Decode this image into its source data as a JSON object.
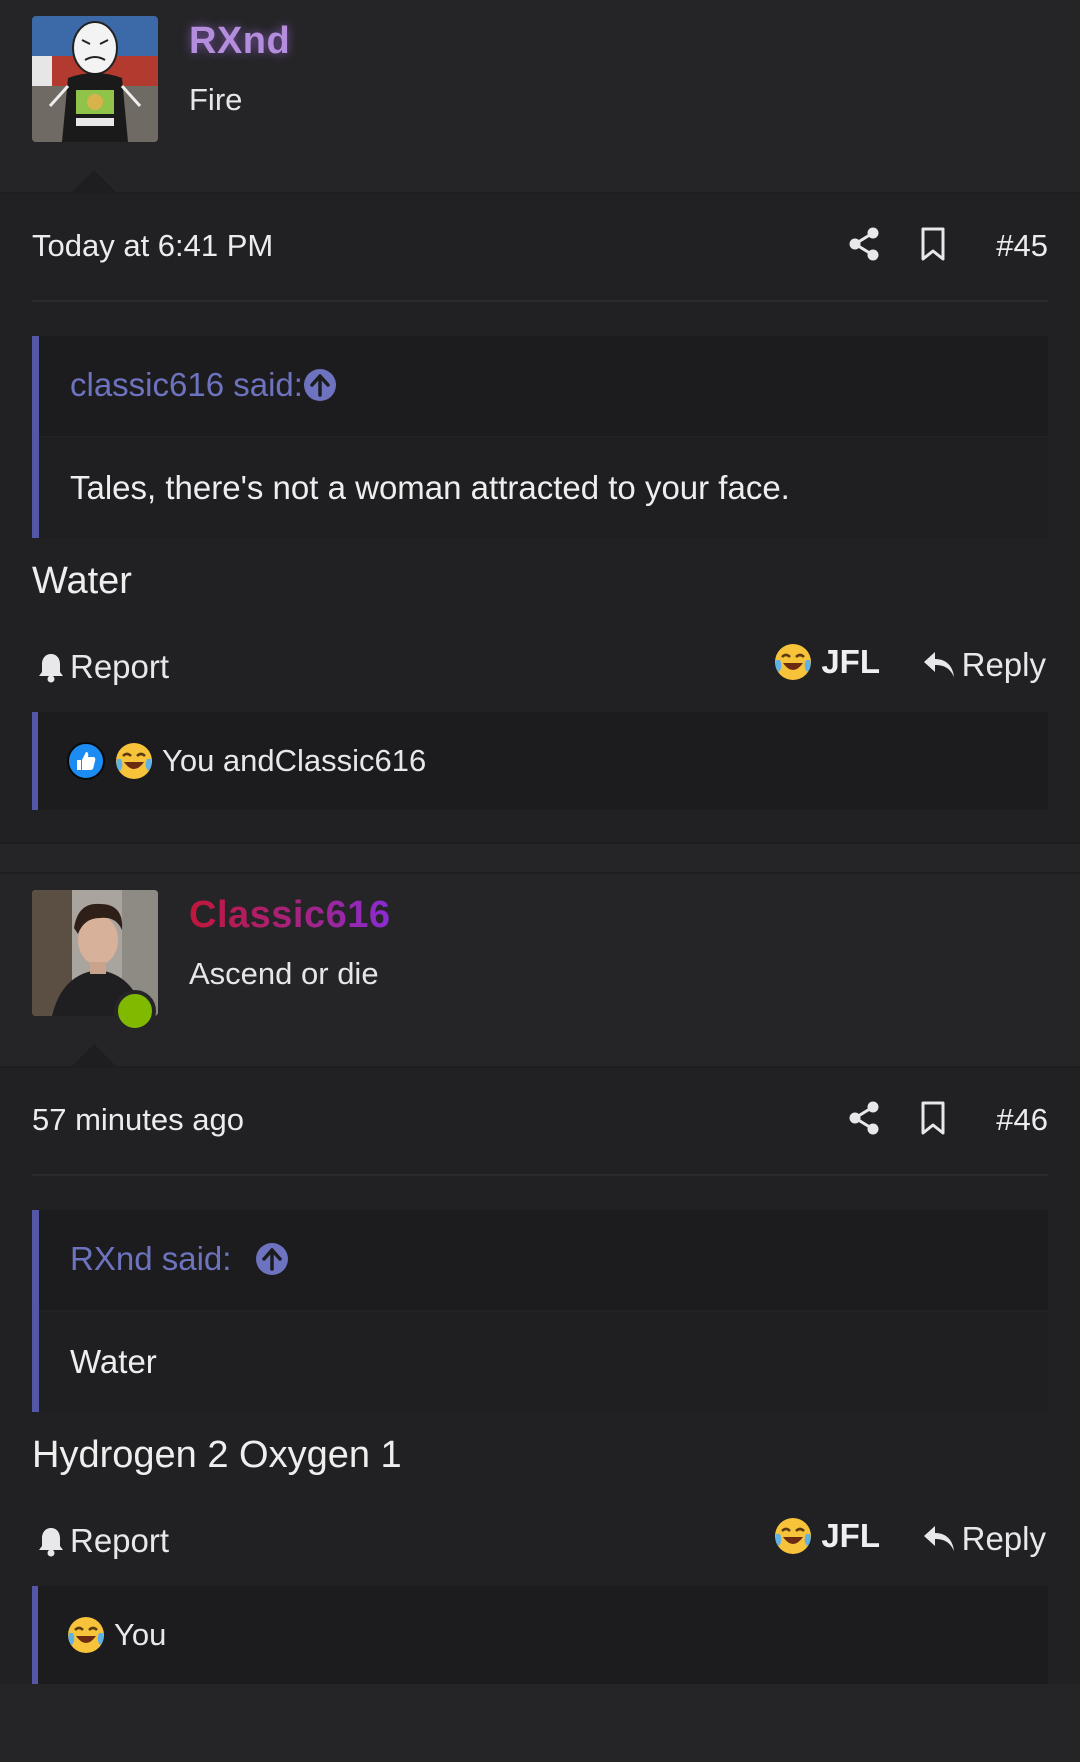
{
  "posts": [
    {
      "username": "RXnd",
      "user_title": "Fire",
      "time": "Today at 6:41 PM",
      "number": "#45",
      "quote": {
        "author": "classic616 said:",
        "text": "Tales, there's not a woman attracted to your face."
      },
      "text": "Water",
      "report_label": "Report",
      "jfl_label": "JFL",
      "reply_label": "Reply",
      "reactions_text": "You andClassic616"
    },
    {
      "username": "Classic616",
      "user_title": "Ascend or die",
      "time": "57 minutes ago",
      "number": "#46",
      "quote": {
        "author": "RXnd said:",
        "text": "Water"
      },
      "text": "Hydrogen 2 Oxygen 1",
      "report_label": "Report",
      "jfl_label": "JFL",
      "reply_label": "Reply",
      "reactions_text": "You"
    }
  ],
  "colors": {
    "background": "#252527",
    "post_body": "#212123",
    "quote_bg": "#1c1c1e",
    "quote_border": "#5457a5",
    "quote_author": "#6d73bf",
    "rxnd_name": "#b48ddd",
    "classic_name_start": "#c2163b",
    "classic_name_end": "#8b2bd6",
    "online": "#7fba00"
  },
  "icons": [
    "share-icon",
    "bookmark-icon",
    "arrow-up-circle-icon",
    "bell-icon",
    "laughing-crying-emoji-icon",
    "reply-arrow-icon",
    "like-thumb-icon"
  ]
}
